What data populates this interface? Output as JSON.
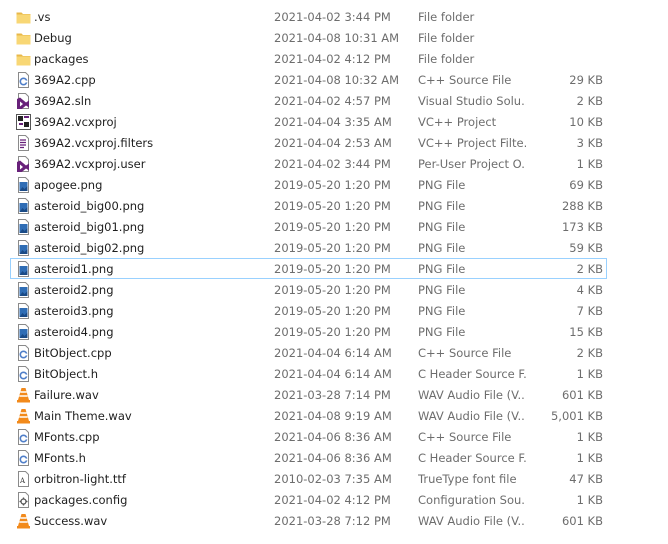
{
  "files": [
    {
      "name": ".vs",
      "date": "2021-04-02 3:44 PM",
      "type": "File folder",
      "size": "",
      "icon": "folder-icon"
    },
    {
      "name": "Debug",
      "date": "2021-04-08 10:31 AM",
      "type": "File folder",
      "size": "",
      "icon": "folder-icon"
    },
    {
      "name": "packages",
      "date": "2021-04-02 4:12 PM",
      "type": "File folder",
      "size": "",
      "icon": "folder-icon"
    },
    {
      "name": "369A2.cpp",
      "date": "2021-04-08 10:32 AM",
      "type": "C++ Source File",
      "size": "29 KB",
      "icon": "cpp-file-icon"
    },
    {
      "name": "369A2.sln",
      "date": "2021-04-02 4:57 PM",
      "type": "Visual Studio Solu...",
      "size": "2 KB",
      "icon": "visual-studio-solution-icon"
    },
    {
      "name": "369A2.vcxproj",
      "date": "2021-04-04 3:35 AM",
      "type": "VC++ Project",
      "size": "10 KB",
      "icon": "vcxproj-file-icon"
    },
    {
      "name": "369A2.vcxproj.filters",
      "date": "2021-04-04 2:53 AM",
      "type": "VC++ Project Filte...",
      "size": "3 KB",
      "icon": "filters-file-icon"
    },
    {
      "name": "369A2.vcxproj.user",
      "date": "2021-04-02 3:44 PM",
      "type": "Per-User Project O...",
      "size": "1 KB",
      "icon": "visual-studio-user-file-icon"
    },
    {
      "name": "apogee.png",
      "date": "2019-05-20 1:20 PM",
      "type": "PNG File",
      "size": "69 KB",
      "icon": "png-file-icon"
    },
    {
      "name": "asteroid_big00.png",
      "date": "2019-05-20 1:20 PM",
      "type": "PNG File",
      "size": "288 KB",
      "icon": "png-file-icon"
    },
    {
      "name": "asteroid_big01.png",
      "date": "2019-05-20 1:20 PM",
      "type": "PNG File",
      "size": "173 KB",
      "icon": "png-file-icon"
    },
    {
      "name": "asteroid_big02.png",
      "date": "2019-05-20 1:20 PM",
      "type": "PNG File",
      "size": "59 KB",
      "icon": "png-file-icon"
    },
    {
      "name": "asteroid1.png",
      "date": "2019-05-20 1:20 PM",
      "type": "PNG File",
      "size": "2 KB",
      "icon": "png-file-icon",
      "selected": true
    },
    {
      "name": "asteroid2.png",
      "date": "2019-05-20 1:20 PM",
      "type": "PNG File",
      "size": "4 KB",
      "icon": "png-file-icon"
    },
    {
      "name": "asteroid3.png",
      "date": "2019-05-20 1:20 PM",
      "type": "PNG File",
      "size": "7 KB",
      "icon": "png-file-icon"
    },
    {
      "name": "asteroid4.png",
      "date": "2019-05-20 1:20 PM",
      "type": "PNG File",
      "size": "15 KB",
      "icon": "png-file-icon"
    },
    {
      "name": "BitObject.cpp",
      "date": "2021-04-04 6:14 AM",
      "type": "C++ Source File",
      "size": "2 KB",
      "icon": "cpp-file-icon"
    },
    {
      "name": "BitObject.h",
      "date": "2021-04-04 6:14 AM",
      "type": "C Header Source F...",
      "size": "1 KB",
      "icon": "header-file-icon"
    },
    {
      "name": "Failure.wav",
      "date": "2021-03-28 7:14 PM",
      "type": "WAV Audio File (V...",
      "size": "601 KB",
      "icon": "vlc-audio-icon"
    },
    {
      "name": "Main Theme.wav",
      "date": "2021-04-08 9:19 AM",
      "type": "WAV Audio File (V...",
      "size": "5,001 KB",
      "icon": "vlc-audio-icon"
    },
    {
      "name": "MFonts.cpp",
      "date": "2021-04-06 8:36 AM",
      "type": "C++ Source File",
      "size": "1 KB",
      "icon": "cpp-file-icon"
    },
    {
      "name": "MFonts.h",
      "date": "2021-04-06 8:36 AM",
      "type": "C Header Source F...",
      "size": "1 KB",
      "icon": "header-file-icon"
    },
    {
      "name": "orbitron-light.ttf",
      "date": "2010-02-03 7:35 AM",
      "type": "TrueType font file",
      "size": "47 KB",
      "icon": "font-file-icon"
    },
    {
      "name": "packages.config",
      "date": "2021-04-02 4:12 PM",
      "type": "Configuration Sou...",
      "size": "1 KB",
      "icon": "config-file-icon"
    },
    {
      "name": "Success.wav",
      "date": "2021-03-28 7:12 PM",
      "type": "WAV Audio File (V...",
      "size": "601 KB",
      "icon": "vlc-audio-icon"
    }
  ],
  "colors": {
    "folder": "#f8d775",
    "folder_dark": "#e8b84a",
    "selection_border": "#99d1ff",
    "vs_purple": "#68217a",
    "vlc_orange": "#f28a1b",
    "cpp_blue": "#4f7ec8"
  }
}
